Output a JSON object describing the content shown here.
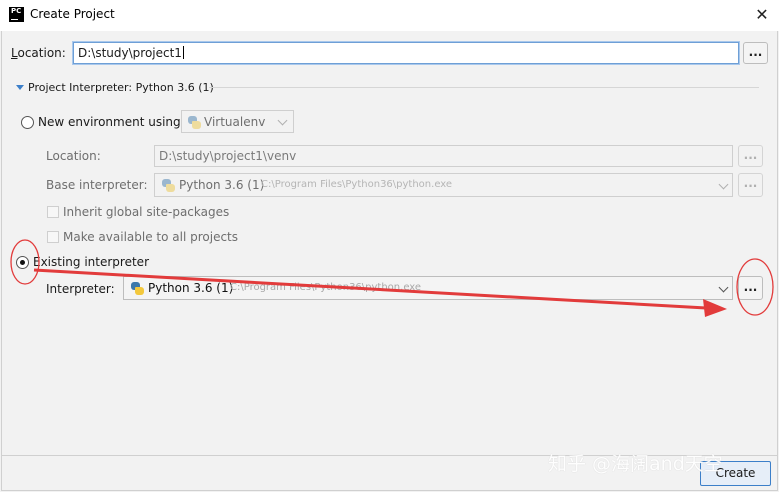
{
  "window": {
    "title": "Create Project",
    "app_icon_text": "PC",
    "close_glyph": "✕"
  },
  "location": {
    "label": "Location:",
    "value": "D:\\study\\project1",
    "browse_label": "..."
  },
  "interpreter_section": {
    "title": "Project Interpreter: Python 3.6 (1)",
    "new_env": {
      "radio_label": "New environment using",
      "tool": "Virtualenv",
      "location_label": "Location:",
      "location_value": "D:\\study\\project1\\venv",
      "base_label": "Base interpreter:",
      "base_name": "Python 3.6 (1)",
      "base_path": "C:\\Program Files\\Python36\\python.exe",
      "inherit_label": "Inherit global site-packages",
      "available_label": "Make available to all projects",
      "browse_label": "..."
    },
    "existing": {
      "radio_label": "Existing interpreter",
      "interpreter_label": "Interpreter:",
      "interpreter_name": "Python 3.6 (1)",
      "interpreter_path": "C:\\Program Files\\Python36\\python.exe",
      "browse_label": "...",
      "selected": true
    }
  },
  "footer": {
    "create_label": "Create"
  },
  "watermark": "知乎 @海阔and天空",
  "annotation_color": "#e23b3b",
  "icons": [
    "pycharm-icon",
    "close-icon",
    "python-icon",
    "chevron-down-icon",
    "expand-triangle-icon"
  ]
}
